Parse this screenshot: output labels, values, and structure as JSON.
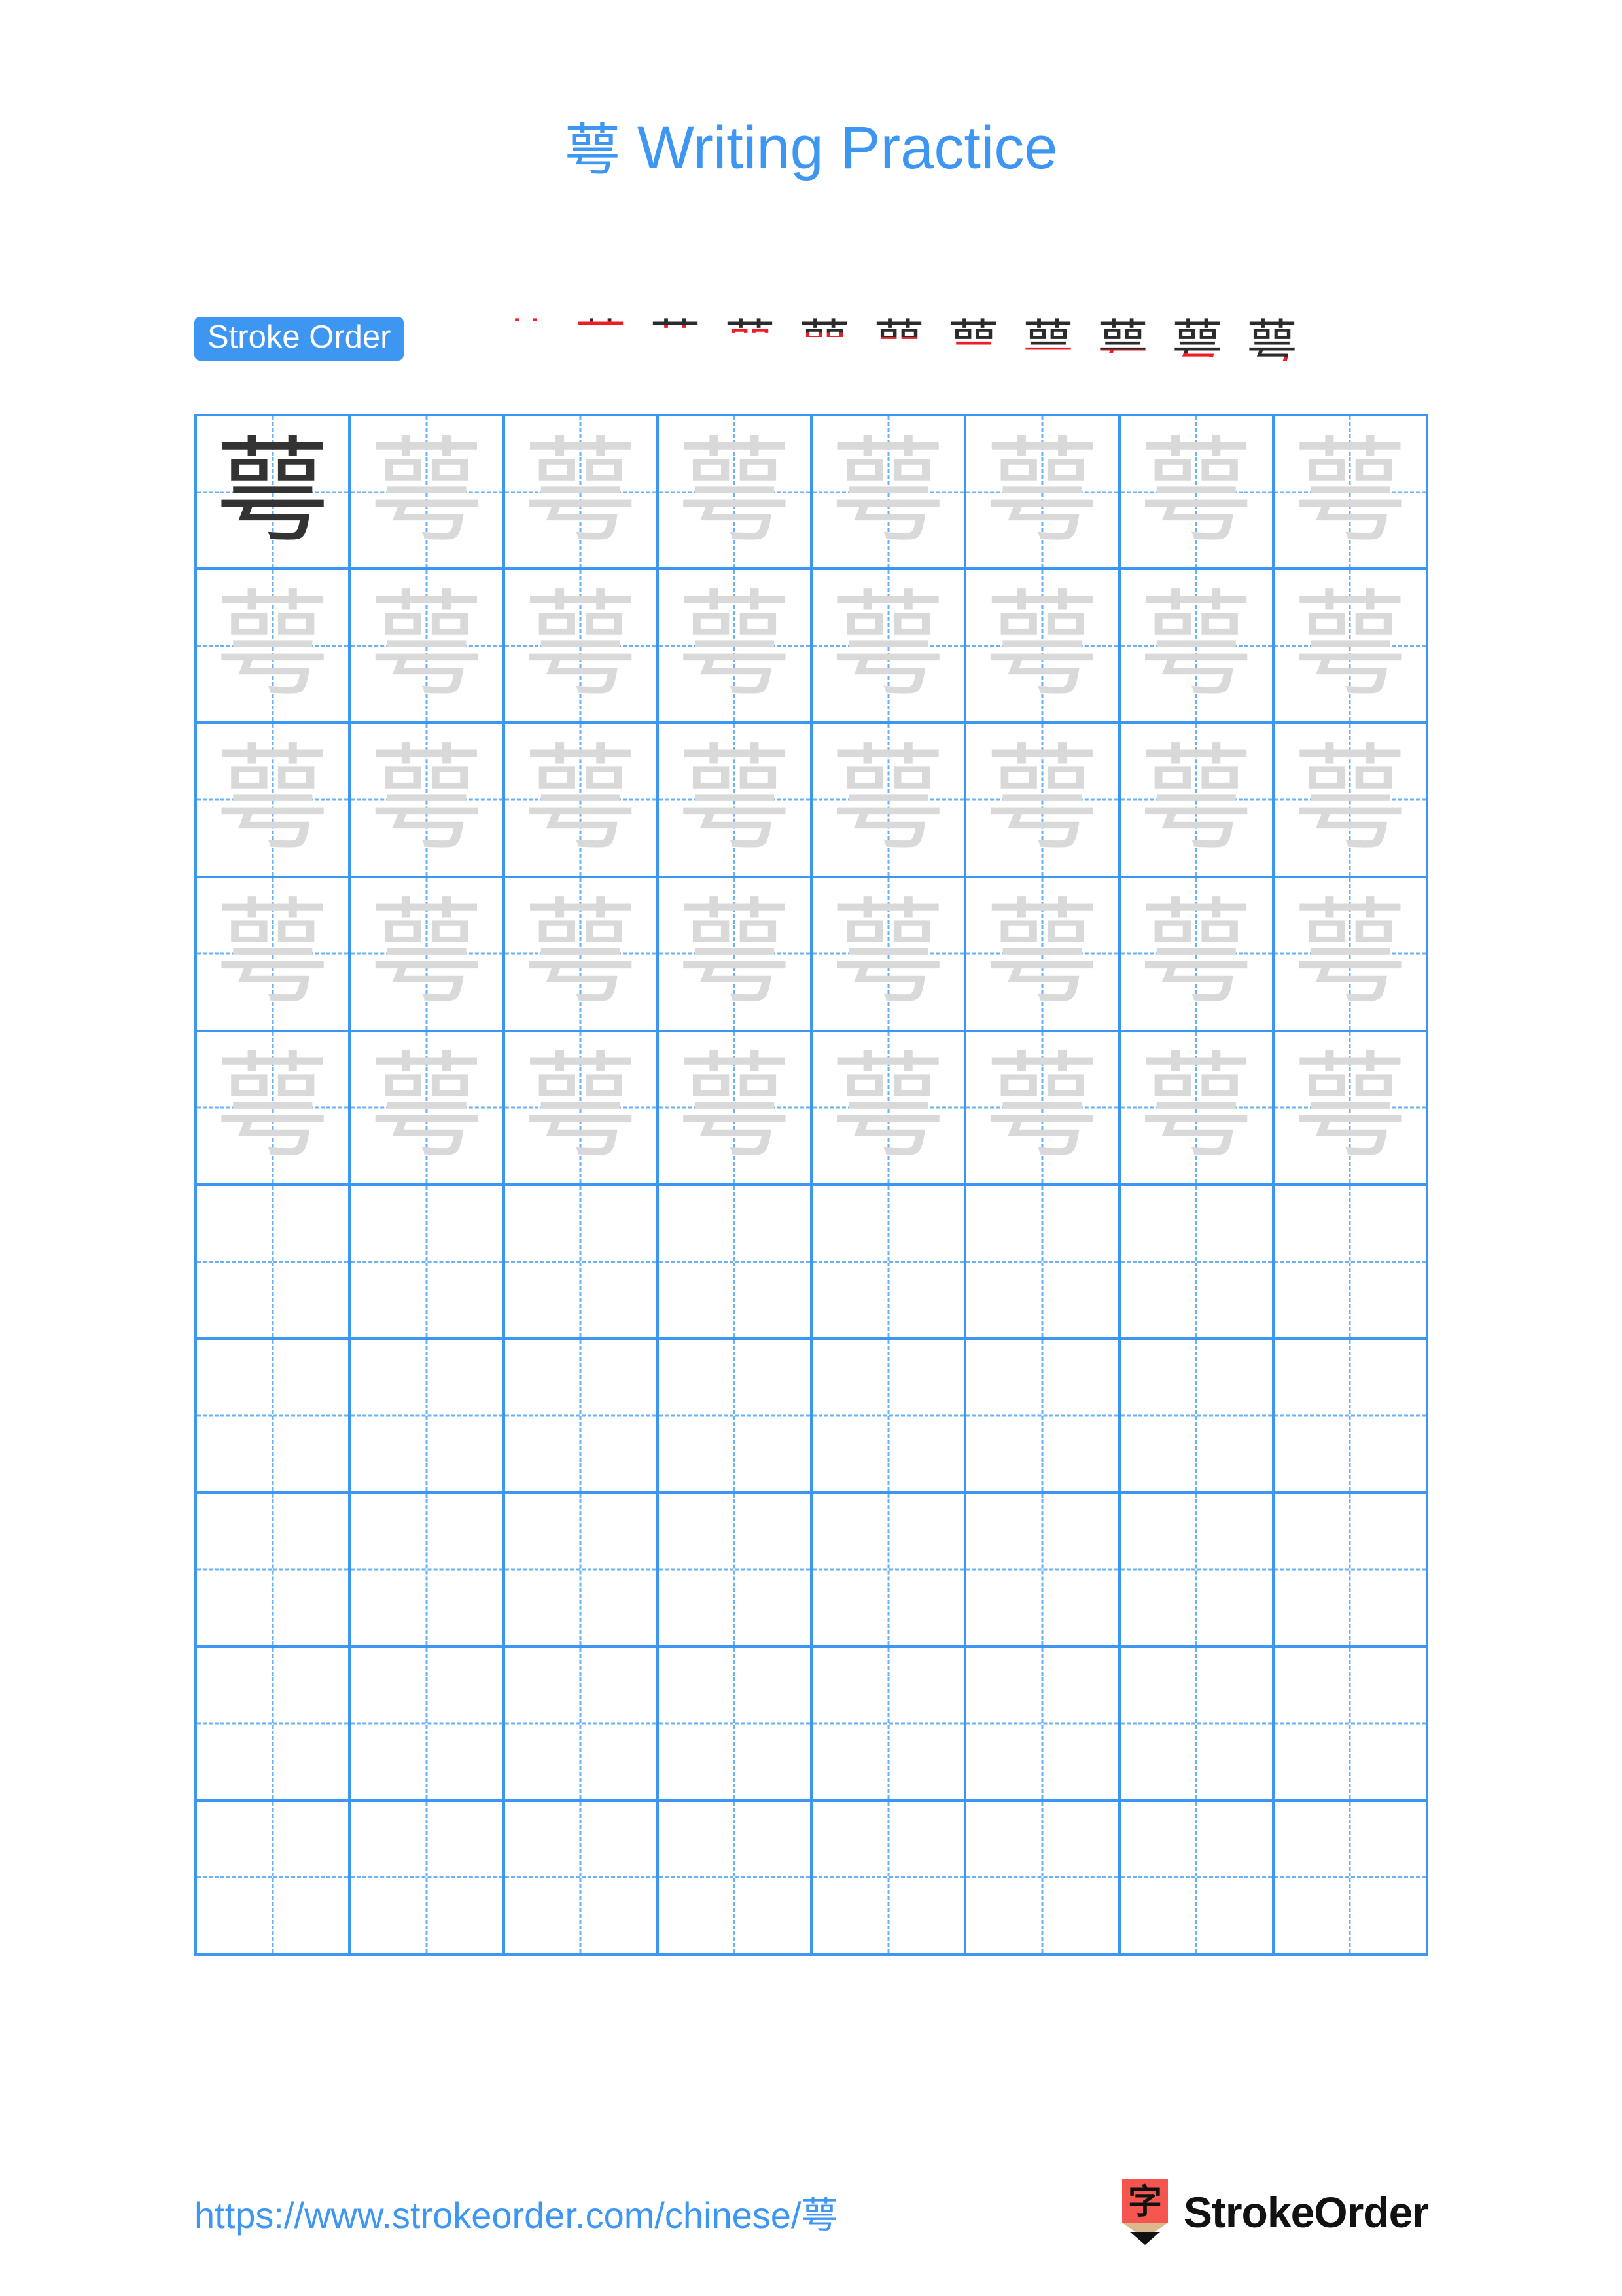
{
  "meta": {
    "character": "萼",
    "stroke_count": 12,
    "colors": {
      "accent_blue": "#3d97f2",
      "grid_line": "#3d97f2",
      "grid_guide": "#5aa9f5",
      "trace_gray": "#d9d9d9",
      "solid_ink": "#333333",
      "new_stroke_red": "#ee1c25",
      "logo_red": "#f4554f",
      "page_background": "#ffffff"
    }
  },
  "header": {
    "title_character": "萼",
    "title_text": " Writing Practice"
  },
  "stroke_order": {
    "badge_label": "Stroke Order",
    "total_steps": 12,
    "steps": [
      {
        "index": 1,
        "strokes_shown": 1,
        "new_stroke": "横"
      },
      {
        "index": 2,
        "strokes_shown": 2,
        "new_stroke": "竖"
      },
      {
        "index": 3,
        "strokes_shown": 3,
        "new_stroke": "竖"
      },
      {
        "index": 4,
        "strokes_shown": 4,
        "new_stroke": "竖"
      },
      {
        "index": 5,
        "strokes_shown": 5,
        "new_stroke": "横折"
      },
      {
        "index": 6,
        "strokes_shown": 6,
        "new_stroke": "横"
      },
      {
        "index": 7,
        "strokes_shown": 7,
        "new_stroke": "竖"
      },
      {
        "index": 8,
        "strokes_shown": 8,
        "new_stroke": "横折"
      },
      {
        "index": 9,
        "strokes_shown": 9,
        "new_stroke": "横"
      },
      {
        "index": 10,
        "strokes_shown": 10,
        "new_stroke": "横"
      },
      {
        "index": 11,
        "strokes_shown": 11,
        "new_stroke": "横"
      },
      {
        "index": 12,
        "strokes_shown": 12,
        "new_stroke": "横折弯钩"
      }
    ]
  },
  "practice_grid": {
    "columns": 8,
    "rows": 10,
    "traced_rows": 5,
    "blank_rows": 5,
    "glyph": "萼",
    "cells": [
      [
        "solid",
        "trace",
        "trace",
        "trace",
        "trace",
        "trace",
        "trace",
        "trace"
      ],
      [
        "trace",
        "trace",
        "trace",
        "trace",
        "trace",
        "trace",
        "trace",
        "trace"
      ],
      [
        "trace",
        "trace",
        "trace",
        "trace",
        "trace",
        "trace",
        "trace",
        "trace"
      ],
      [
        "trace",
        "trace",
        "trace",
        "trace",
        "trace",
        "trace",
        "trace",
        "trace"
      ],
      [
        "trace",
        "trace",
        "trace",
        "trace",
        "trace",
        "trace",
        "trace",
        "trace"
      ],
      [
        "blank",
        "blank",
        "blank",
        "blank",
        "blank",
        "blank",
        "blank",
        "blank"
      ],
      [
        "blank",
        "blank",
        "blank",
        "blank",
        "blank",
        "blank",
        "blank",
        "blank"
      ],
      [
        "blank",
        "blank",
        "blank",
        "blank",
        "blank",
        "blank",
        "blank",
        "blank"
      ],
      [
        "blank",
        "blank",
        "blank",
        "blank",
        "blank",
        "blank",
        "blank",
        "blank"
      ],
      [
        "blank",
        "blank",
        "blank",
        "blank",
        "blank",
        "blank",
        "blank",
        "blank"
      ]
    ]
  },
  "footer": {
    "url_prefix": "https://www.strokeorder.com/chinese/",
    "url_character": "萼",
    "brand_name": "StrokeOrder",
    "brand_mark_character": "字"
  }
}
